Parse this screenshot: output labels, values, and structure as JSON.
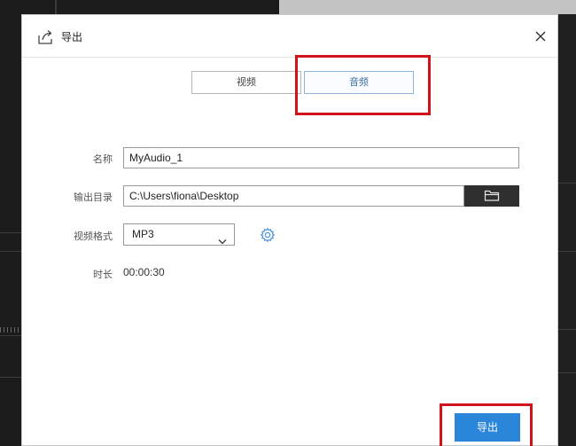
{
  "dialog": {
    "title": "导出",
    "icon": "export-icon",
    "close_icon": "close-icon"
  },
  "tabs": [
    {
      "label": "视频",
      "selected": false
    },
    {
      "label": "音频",
      "selected": true
    }
  ],
  "form": {
    "name_label": "名称",
    "name_value": "MyAudio_1",
    "output_dir_label": "输出目录",
    "output_dir_value": "C:\\Users\\fiona\\Desktop",
    "folder_icon": "folder-icon",
    "format_label": "视频格式",
    "format_value": "MP3",
    "settings_icon": "gear-icon",
    "duration_label": "时长",
    "duration_value": "00:00:30"
  },
  "export_button": {
    "label": "导出",
    "color": "#2a86d8"
  },
  "highlight_color": "#d0121b"
}
